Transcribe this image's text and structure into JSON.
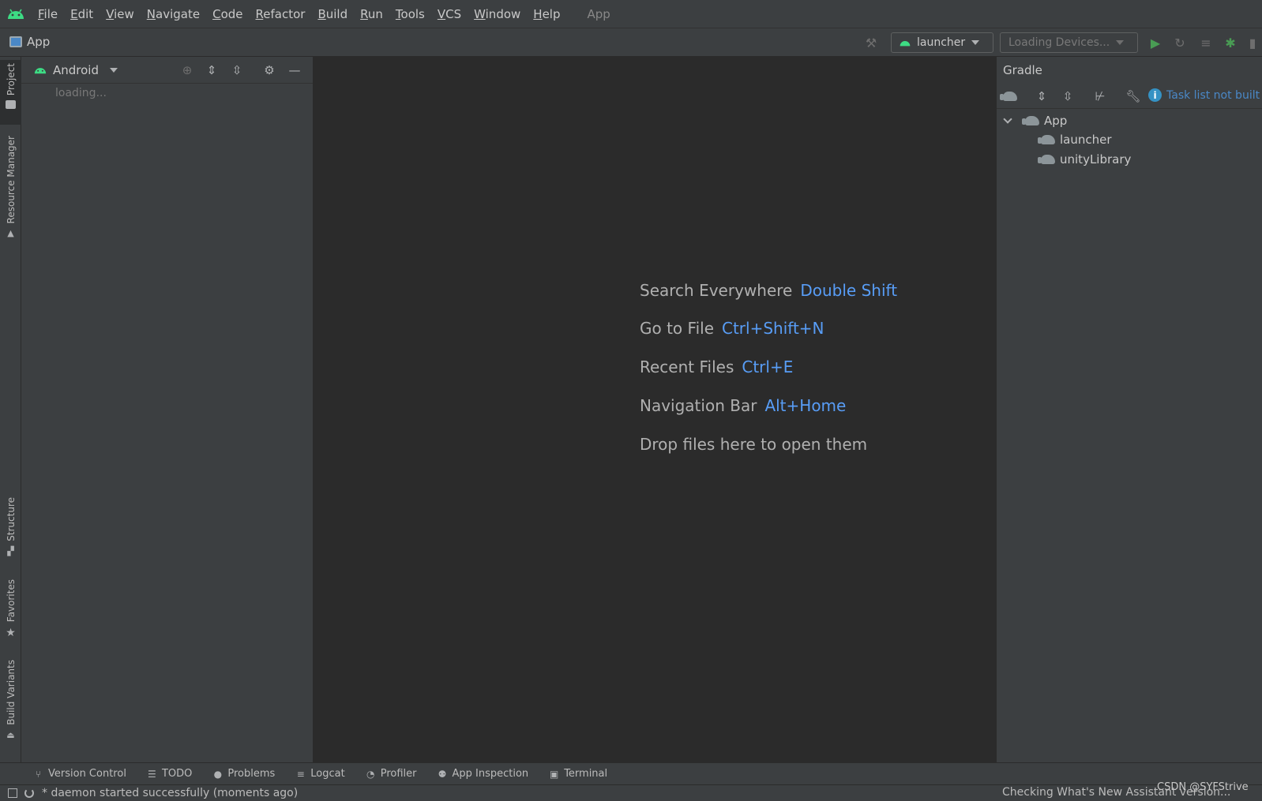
{
  "menubar": {
    "items": [
      "File",
      "Edit",
      "View",
      "Navigate",
      "Code",
      "Refactor",
      "Build",
      "Run",
      "Tools",
      "VCS",
      "Window",
      "Help"
    ],
    "app_title": "App"
  },
  "navbar": {
    "breadcrumb": "App",
    "run_config": "launcher",
    "device_selector": "Loading Devices..."
  },
  "left_stripe": {
    "tabs": [
      "Project",
      "Resource Manager",
      "Structure",
      "Favorites",
      "Build Variants"
    ]
  },
  "project_panel": {
    "view_selector": "Android",
    "loading_text": "loading..."
  },
  "editor": {
    "hints": [
      {
        "label": "Search Everywhere",
        "shortcut": "Double Shift"
      },
      {
        "label": "Go to File",
        "shortcut": "Ctrl+Shift+N"
      },
      {
        "label": "Recent Files",
        "shortcut": "Ctrl+E"
      },
      {
        "label": "Navigation Bar",
        "shortcut": "Alt+Home"
      },
      {
        "label": "Drop files here to open them",
        "shortcut": ""
      }
    ]
  },
  "gradle": {
    "title": "Gradle",
    "task_note": "Task list not built",
    "tree": {
      "root": "App",
      "children": [
        "launcher",
        "unityLibrary"
      ]
    }
  },
  "bottom_bar": {
    "tabs": [
      "Version Control",
      "TODO",
      "Problems",
      "Logcat",
      "Profiler",
      "App Inspection",
      "Terminal"
    ]
  },
  "status_bar": {
    "message": "* daemon started successfully (moments ago)",
    "right_message": "Checking What's New Assistant version..."
  },
  "watermark": "CSDN @SYFStrive",
  "colors": {
    "accent_blue": "#589df6",
    "android_green": "#3ddc84",
    "run_green": "#499c54"
  }
}
